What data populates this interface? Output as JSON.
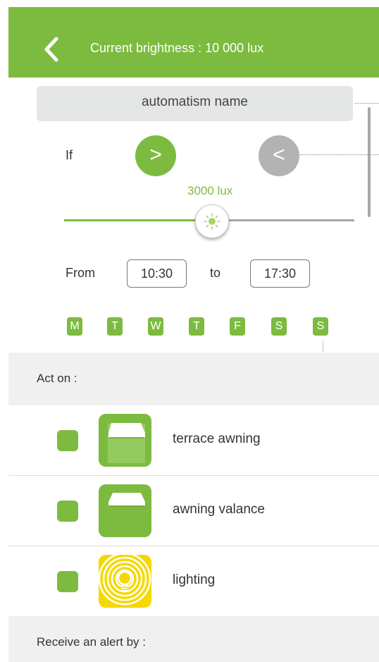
{
  "header": {
    "title": "Current brightness : 10 000 lux"
  },
  "automation": {
    "name": "automatism name"
  },
  "condition": {
    "if_label": "If",
    "greater_symbol": ">",
    "less_symbol": "<",
    "selected": "greater",
    "threshold_label": "3000 lux",
    "slider_fraction": 0.5
  },
  "schedule": {
    "from_label": "From",
    "from_time": "10:30",
    "to_label": "to",
    "to_time": "17:30",
    "days": [
      "M",
      "T",
      "W",
      "T",
      "F",
      "S",
      "S"
    ]
  },
  "act_on": {
    "title": "Act on :",
    "items": [
      {
        "label": "terrace awning",
        "icon": "terrace-awning-icon",
        "checked": true
      },
      {
        "label": "awning valance",
        "icon": "awning-valance-icon",
        "checked": true
      },
      {
        "label": "lighting",
        "icon": "lighting-icon",
        "checked": true
      }
    ]
  },
  "alert": {
    "title": "Receive an alert by :"
  },
  "colors": {
    "accent": "#7cbb3f",
    "inactive": "#b3b3b3",
    "lighting": "#f5d800"
  }
}
